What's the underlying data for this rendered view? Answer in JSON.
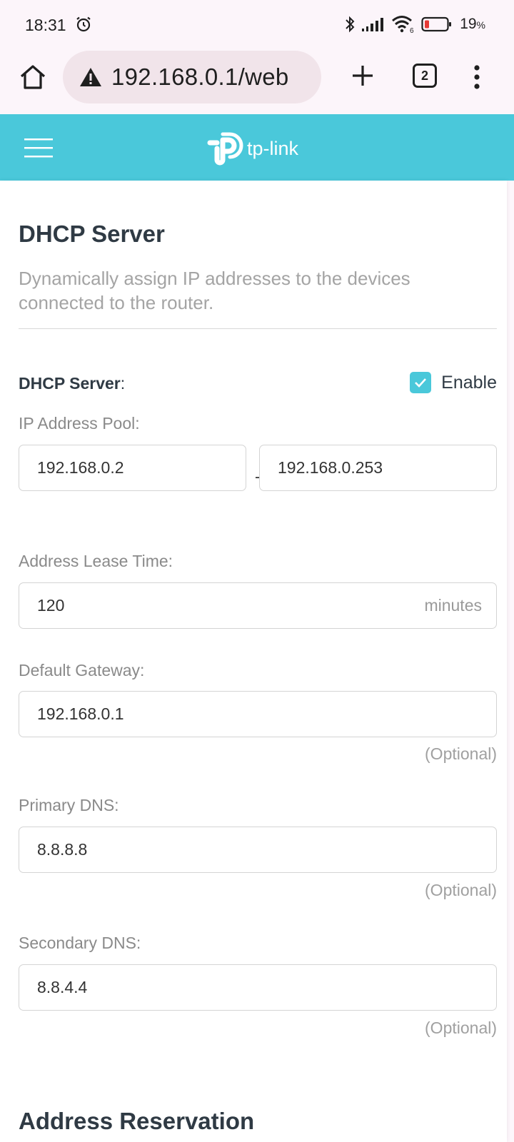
{
  "status_bar": {
    "time": "18:31",
    "battery": "19",
    "battery_unit": "%"
  },
  "browser": {
    "url": "192.168.0.1/web",
    "tab_count": "2"
  },
  "header": {
    "brand": "tp-link",
    "accent_color": "#4ac8da"
  },
  "page": {
    "title": "DHCP Server",
    "description": "Dynamically assign IP addresses to the devices connected to the router.",
    "dhcp_label": "DHCP Server",
    "dhcp_label_colon": ":",
    "enable_label": "Enable",
    "enable_checked": true,
    "pool_label": "IP Address Pool:",
    "pool_start": "192.168.0.2",
    "pool_end": "192.168.0.253",
    "pool_separator": "-",
    "lease_label": "Address Lease Time:",
    "lease_value": "120",
    "lease_unit": "minutes",
    "gateway_label": "Default Gateway:",
    "gateway_value": "192.168.0.1",
    "primary_dns_label": "Primary DNS:",
    "primary_dns_value": "8.8.8.8",
    "secondary_dns_label": "Secondary DNS:",
    "secondary_dns_value": "8.8.4.4",
    "optional_text": "(Optional)",
    "next_section_title": "Address Reservation"
  }
}
